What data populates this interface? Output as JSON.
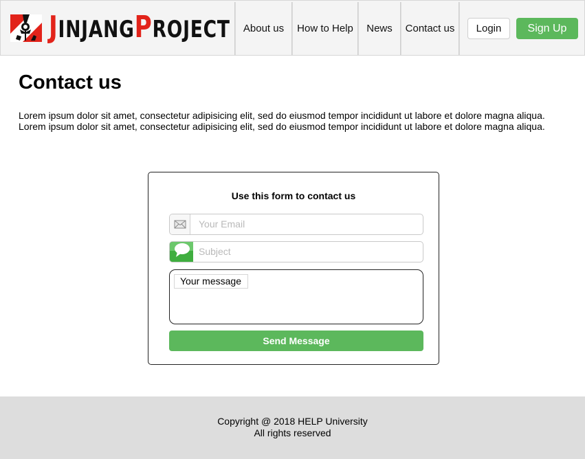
{
  "brand": {
    "logo_text_first": "J",
    "logo_text_first_rest": "INJANG",
    "logo_text_second": "P",
    "logo_text_second_rest": "ROJECT",
    "red": "#e2231a"
  },
  "nav": {
    "items": [
      {
        "label": "About us"
      },
      {
        "label": "How to Help"
      },
      {
        "label": "News"
      },
      {
        "label": "Contact us"
      }
    ],
    "login_label": "Login",
    "signup_label": "Sign Up",
    "accent": "#5cb85c"
  },
  "main": {
    "title": "Contact us",
    "intro": "Lorem ipsum dolor sit amet, consectetur adipisicing elit, sed do eiusmod tempor incididunt ut labore et dolore magna aliqua. Lorem ipsum dolor sit amet, consectetur adipisicing elit, sed do eiusmod tempor incididunt ut labore et dolore magna aliqua."
  },
  "form": {
    "heading": "Use this form to contact us",
    "email_placeholder": "Your Email",
    "email_icon": "envelope-icon",
    "subject_placeholder": "Subject",
    "subject_icon": "chat-bubble-icon",
    "message_placeholder": "Your message",
    "send_label": "Send Message"
  },
  "footer": {
    "copyright": "Copyright @ 2018 HELP University",
    "rights": "All rights reserved"
  }
}
